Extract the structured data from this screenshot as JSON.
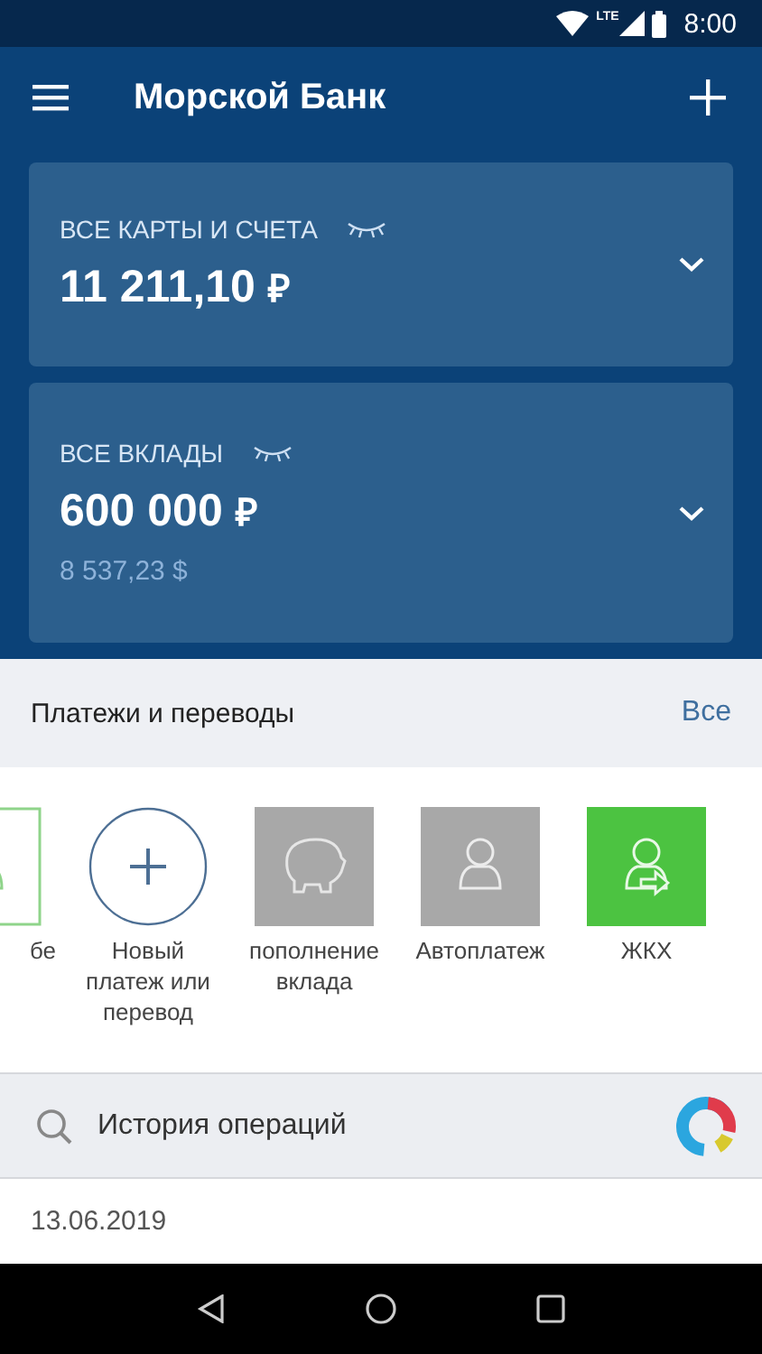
{
  "status_bar": {
    "time": "8:00",
    "network": "LTE"
  },
  "app_bar": {
    "title": "Морской Банк"
  },
  "accounts": [
    {
      "label": "ВСЕ КАРТЫ И СЧЕТА",
      "amount": "11 211,10",
      "currency": "₽"
    },
    {
      "label": "ВСЕ ВКЛАДЫ",
      "amount": "600 000",
      "currency": "₽",
      "secondary": "8 537,23 $"
    }
  ],
  "payments": {
    "title": "Платежи и переводы",
    "all_link": "Все",
    "items": [
      {
        "kind": "outline",
        "label": "бе"
      },
      {
        "kind": "add",
        "label": "Новый платеж или перевод"
      },
      {
        "kind": "piggy",
        "label": "пополнение вклада"
      },
      {
        "kind": "person",
        "label": "Автоплатеж"
      },
      {
        "kind": "transfer",
        "label": "ЖКХ"
      }
    ]
  },
  "history": {
    "placeholder": "История операций"
  },
  "date_row": {
    "date": "13.06.2019"
  }
}
